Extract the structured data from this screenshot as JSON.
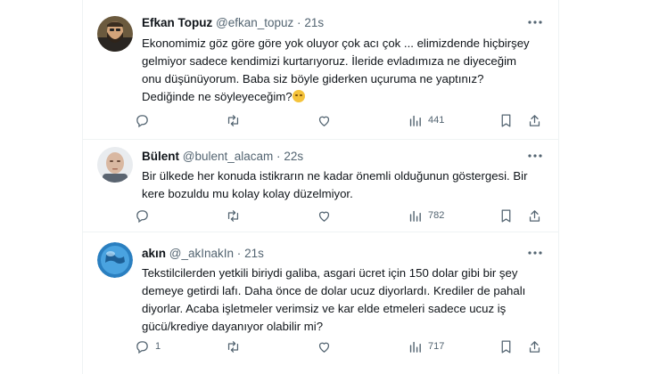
{
  "colors": {
    "text": "#0f1419",
    "muted": "#536471",
    "divider": "#eff3f4"
  },
  "tweets": [
    {
      "name": "Efkan Topuz",
      "handle": "@efkan_topuz",
      "separator": "·",
      "time": "21s",
      "lines": [
        "Ekonomimiz göz göre göre yok oluyor çok acı çok ... elimizdende hiçbirşey",
        "gelmiyor sadece kendimizi kurtarıyoruz. İleride evladımıza ne diyeceğim",
        "onu düşünüyorum. Baba siz böyle giderken uçuruma ne yaptınız?",
        "Dediğinde ne söyleyeceğim?"
      ],
      "emoji": "pensive-face",
      "views": "441",
      "avatar_icon": "bearded-man-avatar"
    },
    {
      "name": "Bülent",
      "handle": "@bulent_alacam",
      "separator": "·",
      "time": "22s",
      "lines": [
        "Bir ülkede her konuda istikrarın ne kadar önemli olduğunun göstergesi. Bir",
        "kere bozuldu mu kolay kolay düzelmiyor."
      ],
      "views": "782",
      "avatar_icon": "bald-man-avatar"
    },
    {
      "name": "akın",
      "handle": "@_akInakIn",
      "separator": "·",
      "time": "21s",
      "lines": [
        "Tekstilcilerden yetkili biriydi galiba, asgari ücret için 150 dolar gibi bir şey",
        "demeye getirdi lafı. Daha önce de dolar ucuz diyorlardı. Krediler de pahalı",
        "diyorlar. Acaba işletmeler verimsiz ve kar elde etmeleri sadece ucuz iş",
        "gücü/krediye dayanıyor olabilir mi?"
      ],
      "reply_count": "1",
      "views": "717",
      "avatar_icon": "globe-avatar"
    }
  ],
  "icons": {
    "reply": "reply-icon",
    "retweet": "retweet-icon",
    "like": "like-icon",
    "views": "views-icon",
    "bookmark": "bookmark-icon",
    "share": "share-icon",
    "more": "more-icon"
  }
}
